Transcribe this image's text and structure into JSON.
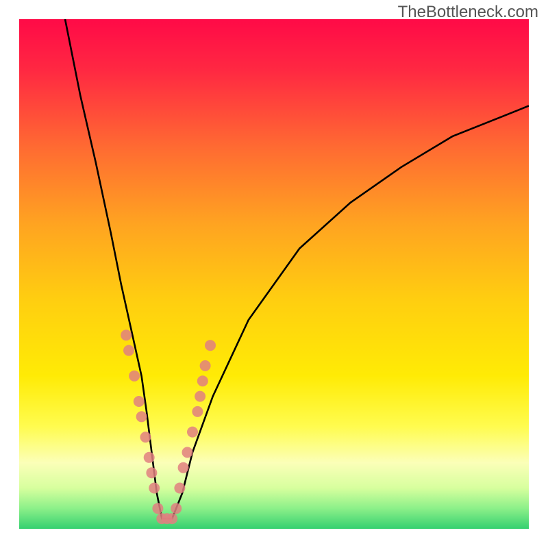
{
  "watermark": "TheBottleneck.com",
  "gradient": {
    "stops": [
      {
        "offset": 0.0,
        "color": "#ff0a47"
      },
      {
        "offset": 0.1,
        "color": "#ff2842"
      },
      {
        "offset": 0.25,
        "color": "#ff6a32"
      },
      {
        "offset": 0.4,
        "color": "#ffa321"
      },
      {
        "offset": 0.55,
        "color": "#ffce10"
      },
      {
        "offset": 0.7,
        "color": "#ffeb05"
      },
      {
        "offset": 0.8,
        "color": "#fffc50"
      },
      {
        "offset": 0.87,
        "color": "#fbffb8"
      },
      {
        "offset": 0.92,
        "color": "#d7ff9e"
      },
      {
        "offset": 0.96,
        "color": "#8cf089"
      },
      {
        "offset": 1.0,
        "color": "#35d070"
      }
    ]
  },
  "chart_data": {
    "type": "line",
    "title": "",
    "xlabel": "",
    "ylabel": "",
    "xlim": [
      0,
      100
    ],
    "ylim": [
      0,
      100
    ],
    "series": [
      {
        "name": "bottleneck-curve",
        "x": [
          9,
          12,
          15,
          18,
          20,
          22,
          24,
          25,
          26,
          27,
          28,
          30,
          32,
          34,
          38,
          45,
          55,
          65,
          75,
          85,
          95,
          100
        ],
        "y": [
          100,
          85,
          72,
          58,
          48,
          39,
          30,
          23,
          15,
          7,
          2,
          2,
          7,
          15,
          26,
          41,
          55,
          64,
          71,
          77,
          81,
          83
        ]
      }
    ],
    "scatter": {
      "name": "marker-dots",
      "color": "#e08080",
      "points": [
        {
          "x": 21.0,
          "y": 38
        },
        {
          "x": 21.5,
          "y": 35
        },
        {
          "x": 22.6,
          "y": 30
        },
        {
          "x": 23.5,
          "y": 25
        },
        {
          "x": 24.0,
          "y": 22
        },
        {
          "x": 24.8,
          "y": 18
        },
        {
          "x": 25.5,
          "y": 14
        },
        {
          "x": 26.0,
          "y": 11
        },
        {
          "x": 26.5,
          "y": 8
        },
        {
          "x": 27.2,
          "y": 4
        },
        {
          "x": 28.0,
          "y": 2
        },
        {
          "x": 29.0,
          "y": 2
        },
        {
          "x": 30.0,
          "y": 2
        },
        {
          "x": 30.8,
          "y": 4
        },
        {
          "x": 31.5,
          "y": 8
        },
        {
          "x": 32.2,
          "y": 12
        },
        {
          "x": 33.0,
          "y": 15
        },
        {
          "x": 34.0,
          "y": 19
        },
        {
          "x": 35.0,
          "y": 23
        },
        {
          "x": 35.5,
          "y": 26
        },
        {
          "x": 36.0,
          "y": 29
        },
        {
          "x": 36.5,
          "y": 32
        },
        {
          "x": 37.5,
          "y": 36
        }
      ]
    }
  }
}
